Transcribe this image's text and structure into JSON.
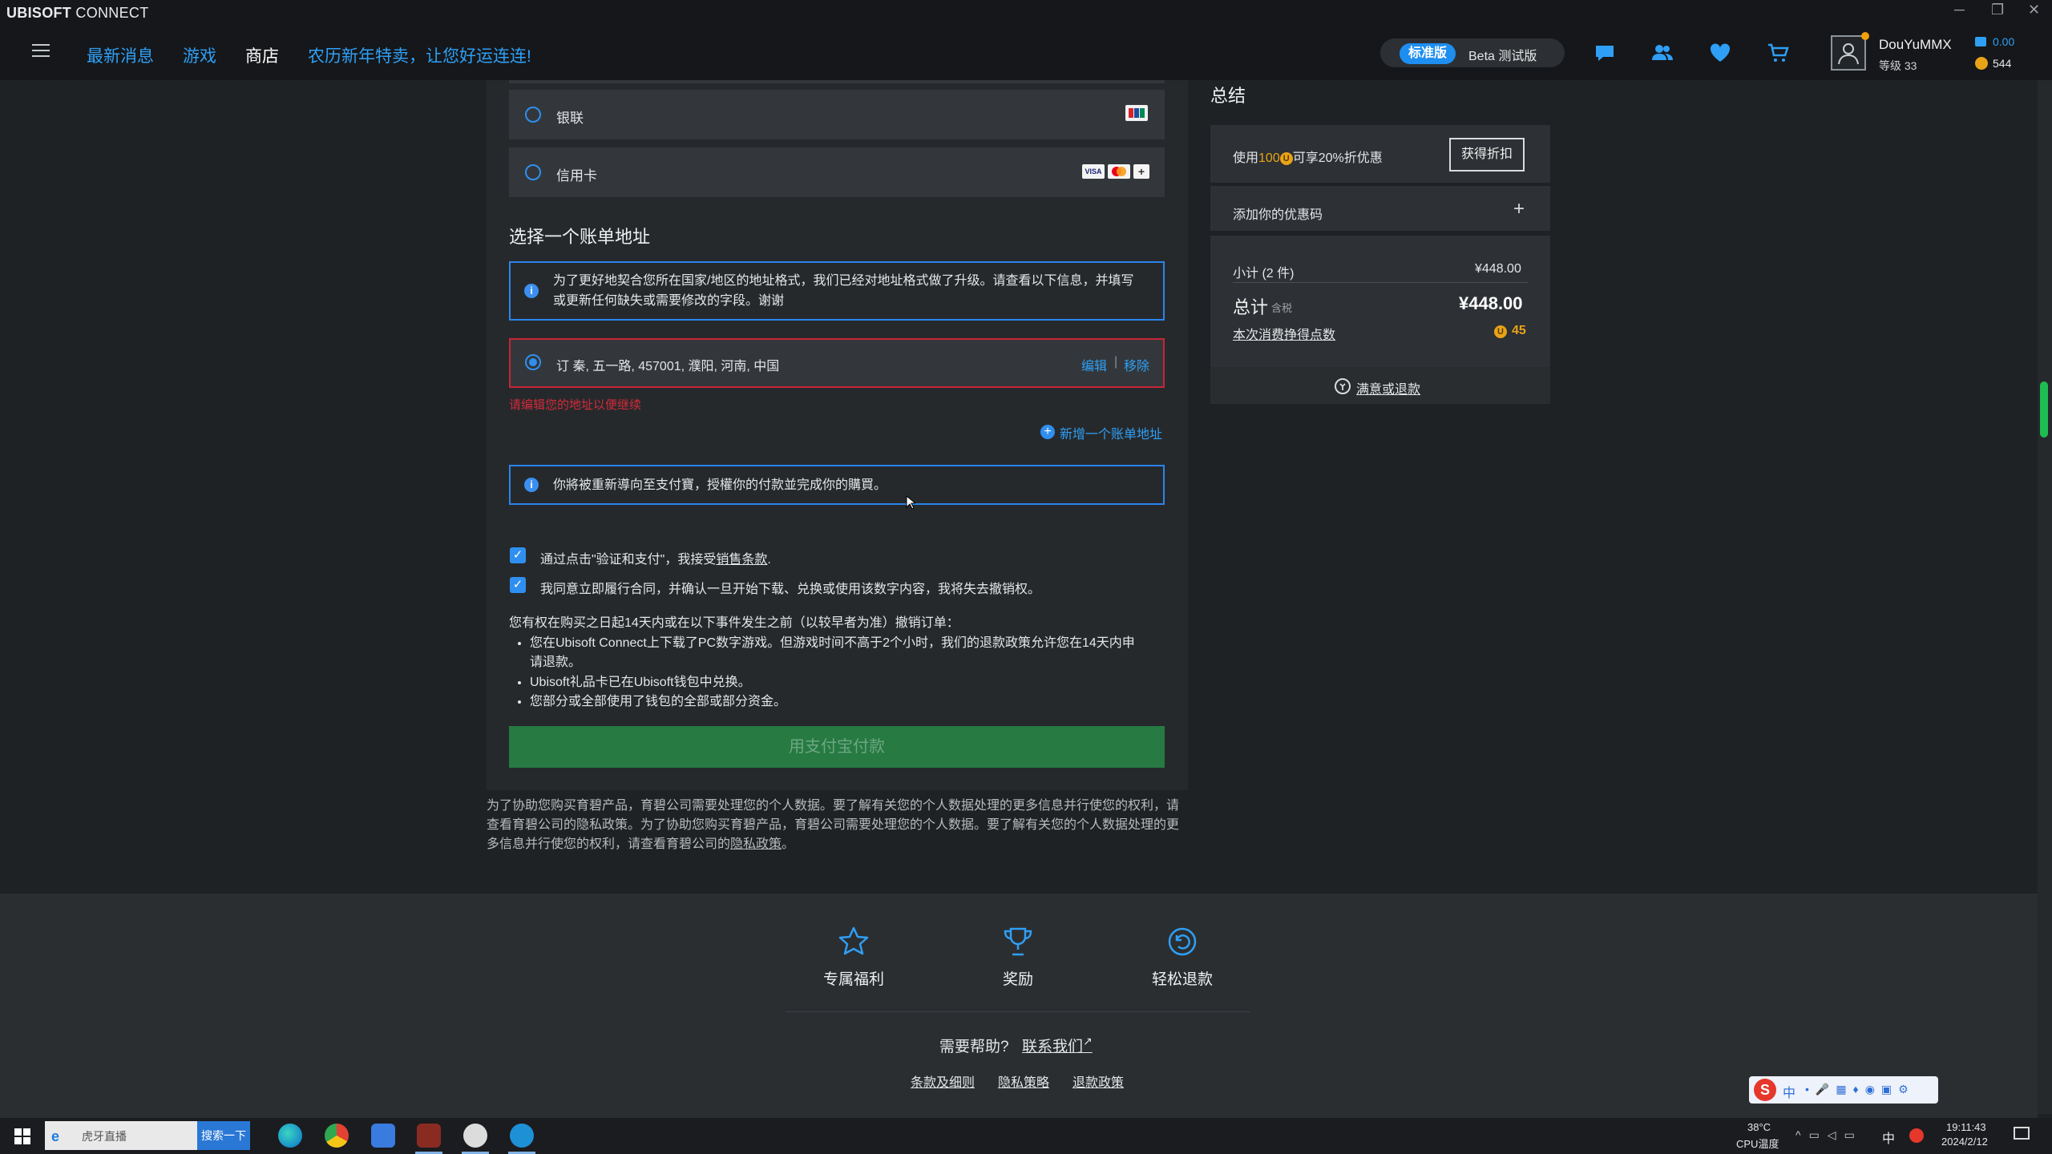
{
  "window": {
    "brand_bold": "UBISOFT",
    "brand_rest": " CONNECT",
    "controls": [
      "─",
      "❐",
      "✕"
    ]
  },
  "nav": {
    "items": [
      "最新消息",
      "游戏",
      "商店",
      "农历新年特卖，让您好运连连!"
    ],
    "active_index": 2
  },
  "topbar": {
    "toggle_standard": "标准版",
    "toggle_beta": "Beta 测试版",
    "icons": [
      "chat-icon",
      "friends-icon",
      "wishlist-heart-icon",
      "cart-icon"
    ],
    "username": "DouYuMMX",
    "level": "等级 33",
    "balance_money": "0.00",
    "balance_coins": "544"
  },
  "payment": {
    "options": [
      {
        "label": "银联",
        "selected": false
      },
      {
        "label": "信用卡",
        "selected": false
      }
    ]
  },
  "billing": {
    "title": "选择一个账单地址",
    "notice_line1": "为了更好地契合您所在国家/地区的地址格式，我们已经对地址格式做了升级。请查看以下信息，并填写",
    "notice_line2": "或更新任何缺失或需要修改的字段。谢谢",
    "address": "订 秦, 五一路, 457001, 濮阳, 河南, 中国",
    "edit_label": "编辑",
    "separator": "|",
    "remove_label": "移除",
    "error": "请编辑您的地址以便继续",
    "add_address": "新增一个账单地址"
  },
  "redirect_notice": "你將被重新導向至支付寶，授權你的付款並完成你的購買。",
  "consents": [
    {
      "text_before": "通过点击\"验证和支付\"，我接受",
      "link": "销售条款",
      "text_after": ".",
      "checked": true
    },
    {
      "text_before": "我同意立即履行合同，并确认一旦开始下载、兑换或使用该数字内容，我将失去撤销权。",
      "link": "",
      "text_after": "",
      "checked": true
    }
  ],
  "rights": {
    "intro": "您有权在购买之日起14天内或在以下事件发生之前（以较早者为准）撤销订单：",
    "bullets": [
      "您在Ubisoft Connect上下载了PC数字游戏。但游戏时间不高于2个小时，我们的退款政策允许您在14天内申请退款。",
      "Ubisoft礼品卡已在Ubisoft钱包中兑换。",
      "您部分或全部使用了钱包的全部或部分资金。"
    ]
  },
  "pay_button": "用支付宝付款",
  "privacy_text": "为了协助您购买育碧产品，育碧公司需要处理您的个人数据。要了解有关您的个人数据处理的更多信息并行使您的权利，请查看育碧公司的隐私政策。为了协助您购买育碧产品，育碧公司需要处理您的个人数据。要了解有关您的个人数据处理的更多信息并行使您的权利，请查看育碧公司的",
  "privacy_link": "隐私政策",
  "privacy_end": "。",
  "summary": {
    "title": "总结",
    "coin_offer_prefix": "使用",
    "coin_offer_amount": "100",
    "coin_offer_suffix": "可享20%折优惠",
    "get_discount": "获得折扣",
    "add_promo": "添加你的优惠码",
    "subtotal_label": "小计 (2 件)",
    "subtotal_value": "¥448.00",
    "total_label": "总计",
    "total_tax": "含税",
    "total_value": "¥448.00",
    "earn_label": "本次消费挣得点数",
    "earn_value": "45",
    "refund": "满意或退款"
  },
  "footer": {
    "perks": [
      "专属福利",
      "奖励",
      "轻松退款"
    ],
    "help": "需要帮助?",
    "contact": "联系我们",
    "links": [
      "条款及细则",
      "隐私策略",
      "退款政策"
    ]
  },
  "taskbar": {
    "search_text": "虎牙直播",
    "search_button": "搜索一下",
    "temp": "38°C",
    "temp_label": "CPU温度",
    "ime_lang": "中",
    "time": "19:11:43",
    "date": "2024/2/12"
  },
  "colors": {
    "accent": "#2f9ff5",
    "error": "#d22a3a",
    "pay_button": "#267a42",
    "coin": "#e8a317"
  }
}
